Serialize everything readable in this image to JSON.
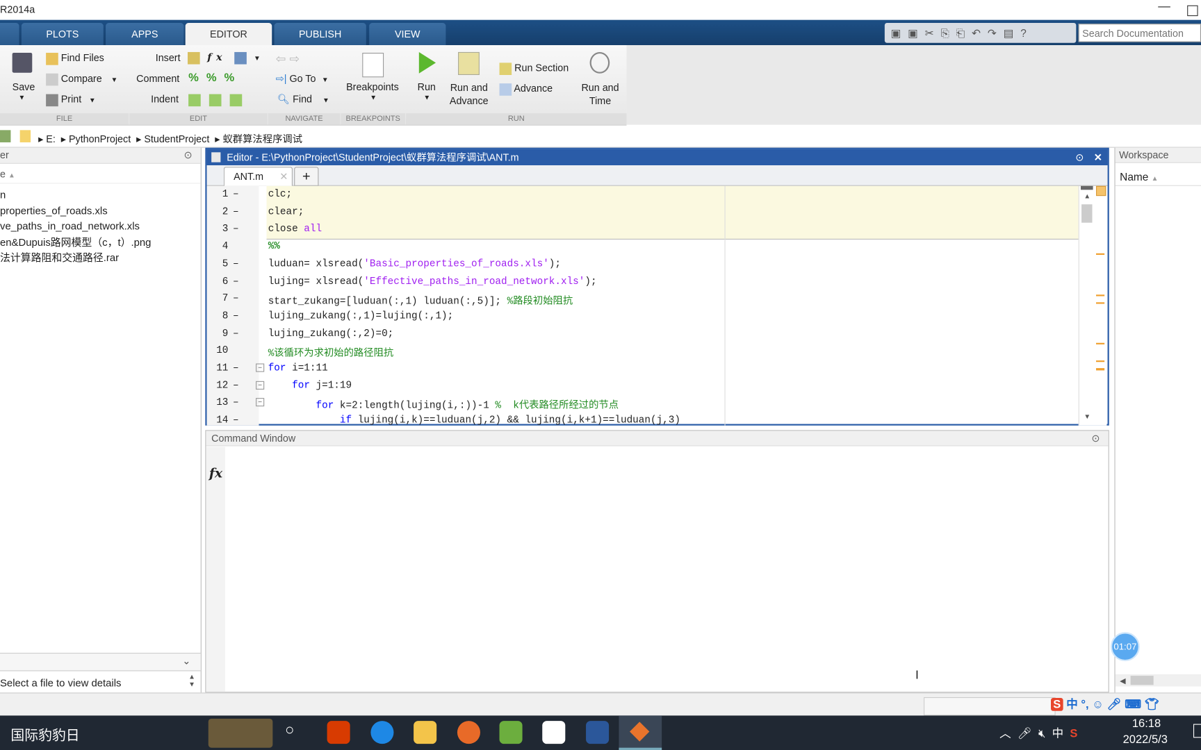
{
  "window": {
    "title": "R2014a"
  },
  "tabs": [
    "PLOTS",
    "APPS",
    "EDITOR",
    "PUBLISH",
    "VIEW"
  ],
  "active_tab": "EDITOR",
  "search": {
    "placeholder": "Search Documentation"
  },
  "ribbon": {
    "file": {
      "label": "FILE",
      "save": "Save",
      "find_files": "Find Files",
      "compare": "Compare",
      "print": "Print"
    },
    "edit": {
      "label": "EDIT",
      "insert": "Insert",
      "comment": "Comment",
      "indent": "Indent"
    },
    "navigate": {
      "label": "NAVIGATE",
      "goto": "Go To",
      "find": "Find"
    },
    "breakpoints": {
      "label": "BREAKPOINTS",
      "button": "Breakpoints"
    },
    "run": {
      "label": "RUN",
      "run": "Run",
      "run_advance_1": "Run and",
      "run_advance_2": "Advance",
      "run_section": "Run Section",
      "advance": "Advance",
      "run_time_1": "Run and",
      "run_time_2": "Time"
    }
  },
  "address": [
    "E:",
    "PythonProject",
    "StudentProject",
    "蚁群算法程序调试"
  ],
  "file_browser": {
    "title": "er",
    "column": "e",
    "files": [
      "n",
      "properties_of_roads.xls",
      "ve_paths_in_road_network.xls",
      "en&Dupuis路网模型（c，t）.png",
      "法计算路阻和交通路径.rar"
    ],
    "details": "Select a file to view details"
  },
  "editor": {
    "title": "Editor - E:\\PythonProject\\StudentProject\\蚁群算法程序调试\\ANT.m",
    "tab": "ANT.m",
    "lines": [
      {
        "n": "1",
        "dash": true,
        "html": "clc;"
      },
      {
        "n": "2",
        "dash": true,
        "html": "clear;"
      },
      {
        "n": "3",
        "dash": true,
        "html": "close <span class='str'>all</span>"
      },
      {
        "n": "4",
        "dash": false,
        "html": "<span class='cm'><b>%%</b></span>"
      },
      {
        "n": "5",
        "dash": true,
        "html": "luduan= xlsread(<span class='str'>'Basic_properties_of_roads.xls'</span>);"
      },
      {
        "n": "6",
        "dash": true,
        "html": "lujing= xlsread(<span class='str'>'Effective_paths_in_road_network.xls'</span>);"
      },
      {
        "n": "7",
        "dash": true,
        "html": "start_zukang=[luduan(:,1) luduan(:,5)]; <span class='cm'>%路段初始阻抗</span>"
      },
      {
        "n": "8",
        "dash": true,
        "html": "lujing_zukang(:,1)=lujing(:,1);"
      },
      {
        "n": "9",
        "dash": true,
        "html": "lujing_zukang(:,2)=0;"
      },
      {
        "n": "10",
        "dash": false,
        "html": "<span class='cm'>%该循环为求初始的路径阻抗</span>"
      },
      {
        "n": "11",
        "dash": true,
        "html": "<span class='kw'>for</span> i=1:11"
      },
      {
        "n": "12",
        "dash": true,
        "html": "    <span class='kw'>for</span> j=1:19"
      },
      {
        "n": "13",
        "dash": true,
        "html": "        <span class='kw'>for</span> k=2:length(lujing(i,:))-1 <span class='cm'>%  k代表路径所经过的节点</span>"
      },
      {
        "n": "14",
        "dash": true,
        "html": "            <span class='kw'>if</span> lujing(i,k)==luduan(j,2) &amp;&amp; lujing(i,k+1)==luduan(j,3)"
      }
    ]
  },
  "command_window": {
    "title": "Command Window",
    "prompt": "fx"
  },
  "workspace": {
    "title": "Workspace",
    "column": "Name"
  },
  "timer": "01:07",
  "taskbar": {
    "left_text": "国际豹豹日",
    "time": "16:18",
    "date": "2022/5/3",
    "ime": "中"
  }
}
